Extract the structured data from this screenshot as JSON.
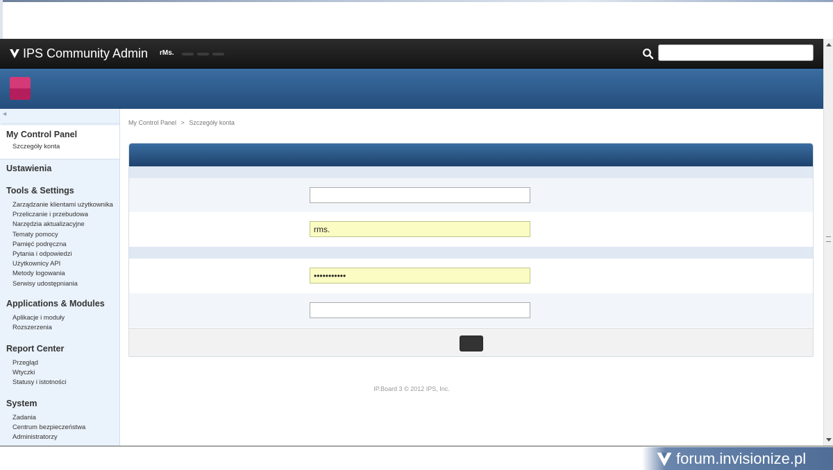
{
  "header": {
    "app_title": "IPS Community Admin",
    "user_name": "rMs."
  },
  "sidebar": {
    "sections": [
      {
        "title": "My Control Panel",
        "items": [
          "Szczegóły konta"
        ]
      },
      {
        "title": "Ustawienia",
        "items": []
      },
      {
        "title": "Tools & Settings",
        "items": [
          "Zarządzanie klientami użytkownika",
          "Przeliczanie i przebudowa",
          "Narzędzia aktualizacyjne",
          "Tematy pomocy",
          "Pamięć podręczna",
          "Pytania i odpowiedzi",
          "Użytkownicy API",
          "Metody logowania",
          "Serwisy udostępniania"
        ]
      },
      {
        "title": "Applications & Modules",
        "items": [
          "Aplikacje i moduły",
          "Rozszerzenia"
        ]
      },
      {
        "title": "Report Center",
        "items": [
          "Przegląd",
          "Wtyczki",
          "Statusy i istotności"
        ]
      },
      {
        "title": "System",
        "items": [
          "Zadania",
          "Centrum bezpieczeństwa",
          "Administratorzy"
        ]
      }
    ]
  },
  "breadcrumb": {
    "root": "My Control Panel",
    "separator": ">",
    "current": "Szczegóły konta"
  },
  "form": {
    "field1_value": "",
    "field2_value": "rms.",
    "field3_value": "•••••••••••",
    "field4_value": ""
  },
  "footer": {
    "copyright": "IP.Board 3 © 2012 IPS, Inc."
  },
  "watermark": {
    "text": "forum.invisionize.pl"
  },
  "colors": {
    "header_bg": "#1c1c1c",
    "banner_blue": "#2f5d8f",
    "sidebar_bg": "#eaf2fb",
    "autofill_yellow": "#fbfcc3",
    "app_icon_pink": "#c92a6a"
  }
}
